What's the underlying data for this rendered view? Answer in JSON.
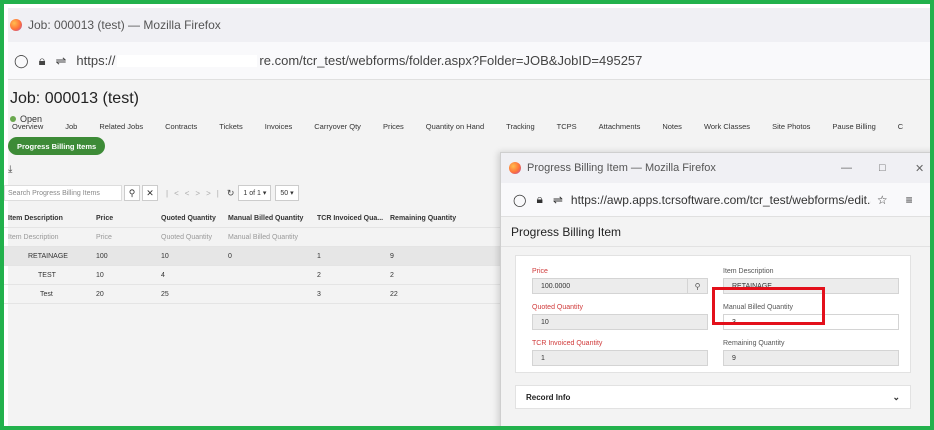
{
  "main_window": {
    "title": "Job: 000013 (test) — Mozilla Firefox",
    "url_prefix": "https://",
    "url_suffix": "re.com/tcr_test/webforms/folder.aspx?Folder=JOB&JobID=495257"
  },
  "job": {
    "title": "Job: 000013 (test)",
    "status": "Open"
  },
  "tabs": [
    "Overview",
    "Job",
    "Related Jobs",
    "Contracts",
    "Tickets",
    "Invoices",
    "Carryover Qty",
    "Prices",
    "Quantity on Hand",
    "Tracking",
    "TCPS",
    "Attachments",
    "Notes",
    "Work Classes",
    "Site Photos",
    "Pause Billing",
    "C"
  ],
  "active_tab": "Progress Billing Items",
  "toolbar": {
    "download_icon": "download-icon",
    "search_placeholder": "Search Progress Billing Items",
    "search_icon": "search-icon",
    "clear_icon": "close-icon",
    "pager": "1 of 1",
    "page_size": "50"
  },
  "grid": {
    "headers": [
      "Item Description",
      "Price",
      "Quoted Quantity",
      "Manual Billed Quantity",
      "TCR Invoiced Qua...",
      "Remaining Quantity"
    ],
    "filters": [
      "Item Description",
      "Price",
      "Quoted Quantity",
      "Manual Billed Quantity"
    ],
    "rows": [
      [
        "RETAINAGE",
        "100",
        "10",
        "0",
        "1",
        "9"
      ],
      [
        "TEST",
        "10",
        "4",
        "",
        "2",
        "2"
      ],
      [
        "Test",
        "20",
        "25",
        "",
        "3",
        "22"
      ]
    ]
  },
  "popup": {
    "title": "Progress Billing Item — Mozilla Firefox",
    "url": "https://awp.apps.tcrsoftware.com/tcr_test/webforms/edit.as|",
    "heading": "Progress Billing Item",
    "fields": {
      "price_label": "Price",
      "price_value": "100.0000",
      "item_desc_label": "Item Description",
      "item_desc_value": "RETAINAGE",
      "quoted_label": "Quoted Quantity",
      "quoted_value": "10",
      "manual_label": "Manual Billed Quantity",
      "manual_value": "3",
      "tcr_label": "TCR Invoiced Quantity",
      "tcr_value": "1",
      "remaining_label": "Remaining Quantity",
      "remaining_value": "9"
    },
    "record_info": "Record Info"
  },
  "colors": {
    "frame": "#22b14c",
    "pill": "#3d8b37",
    "highlight": "#e3101b",
    "required_label": "#d03a3a"
  }
}
